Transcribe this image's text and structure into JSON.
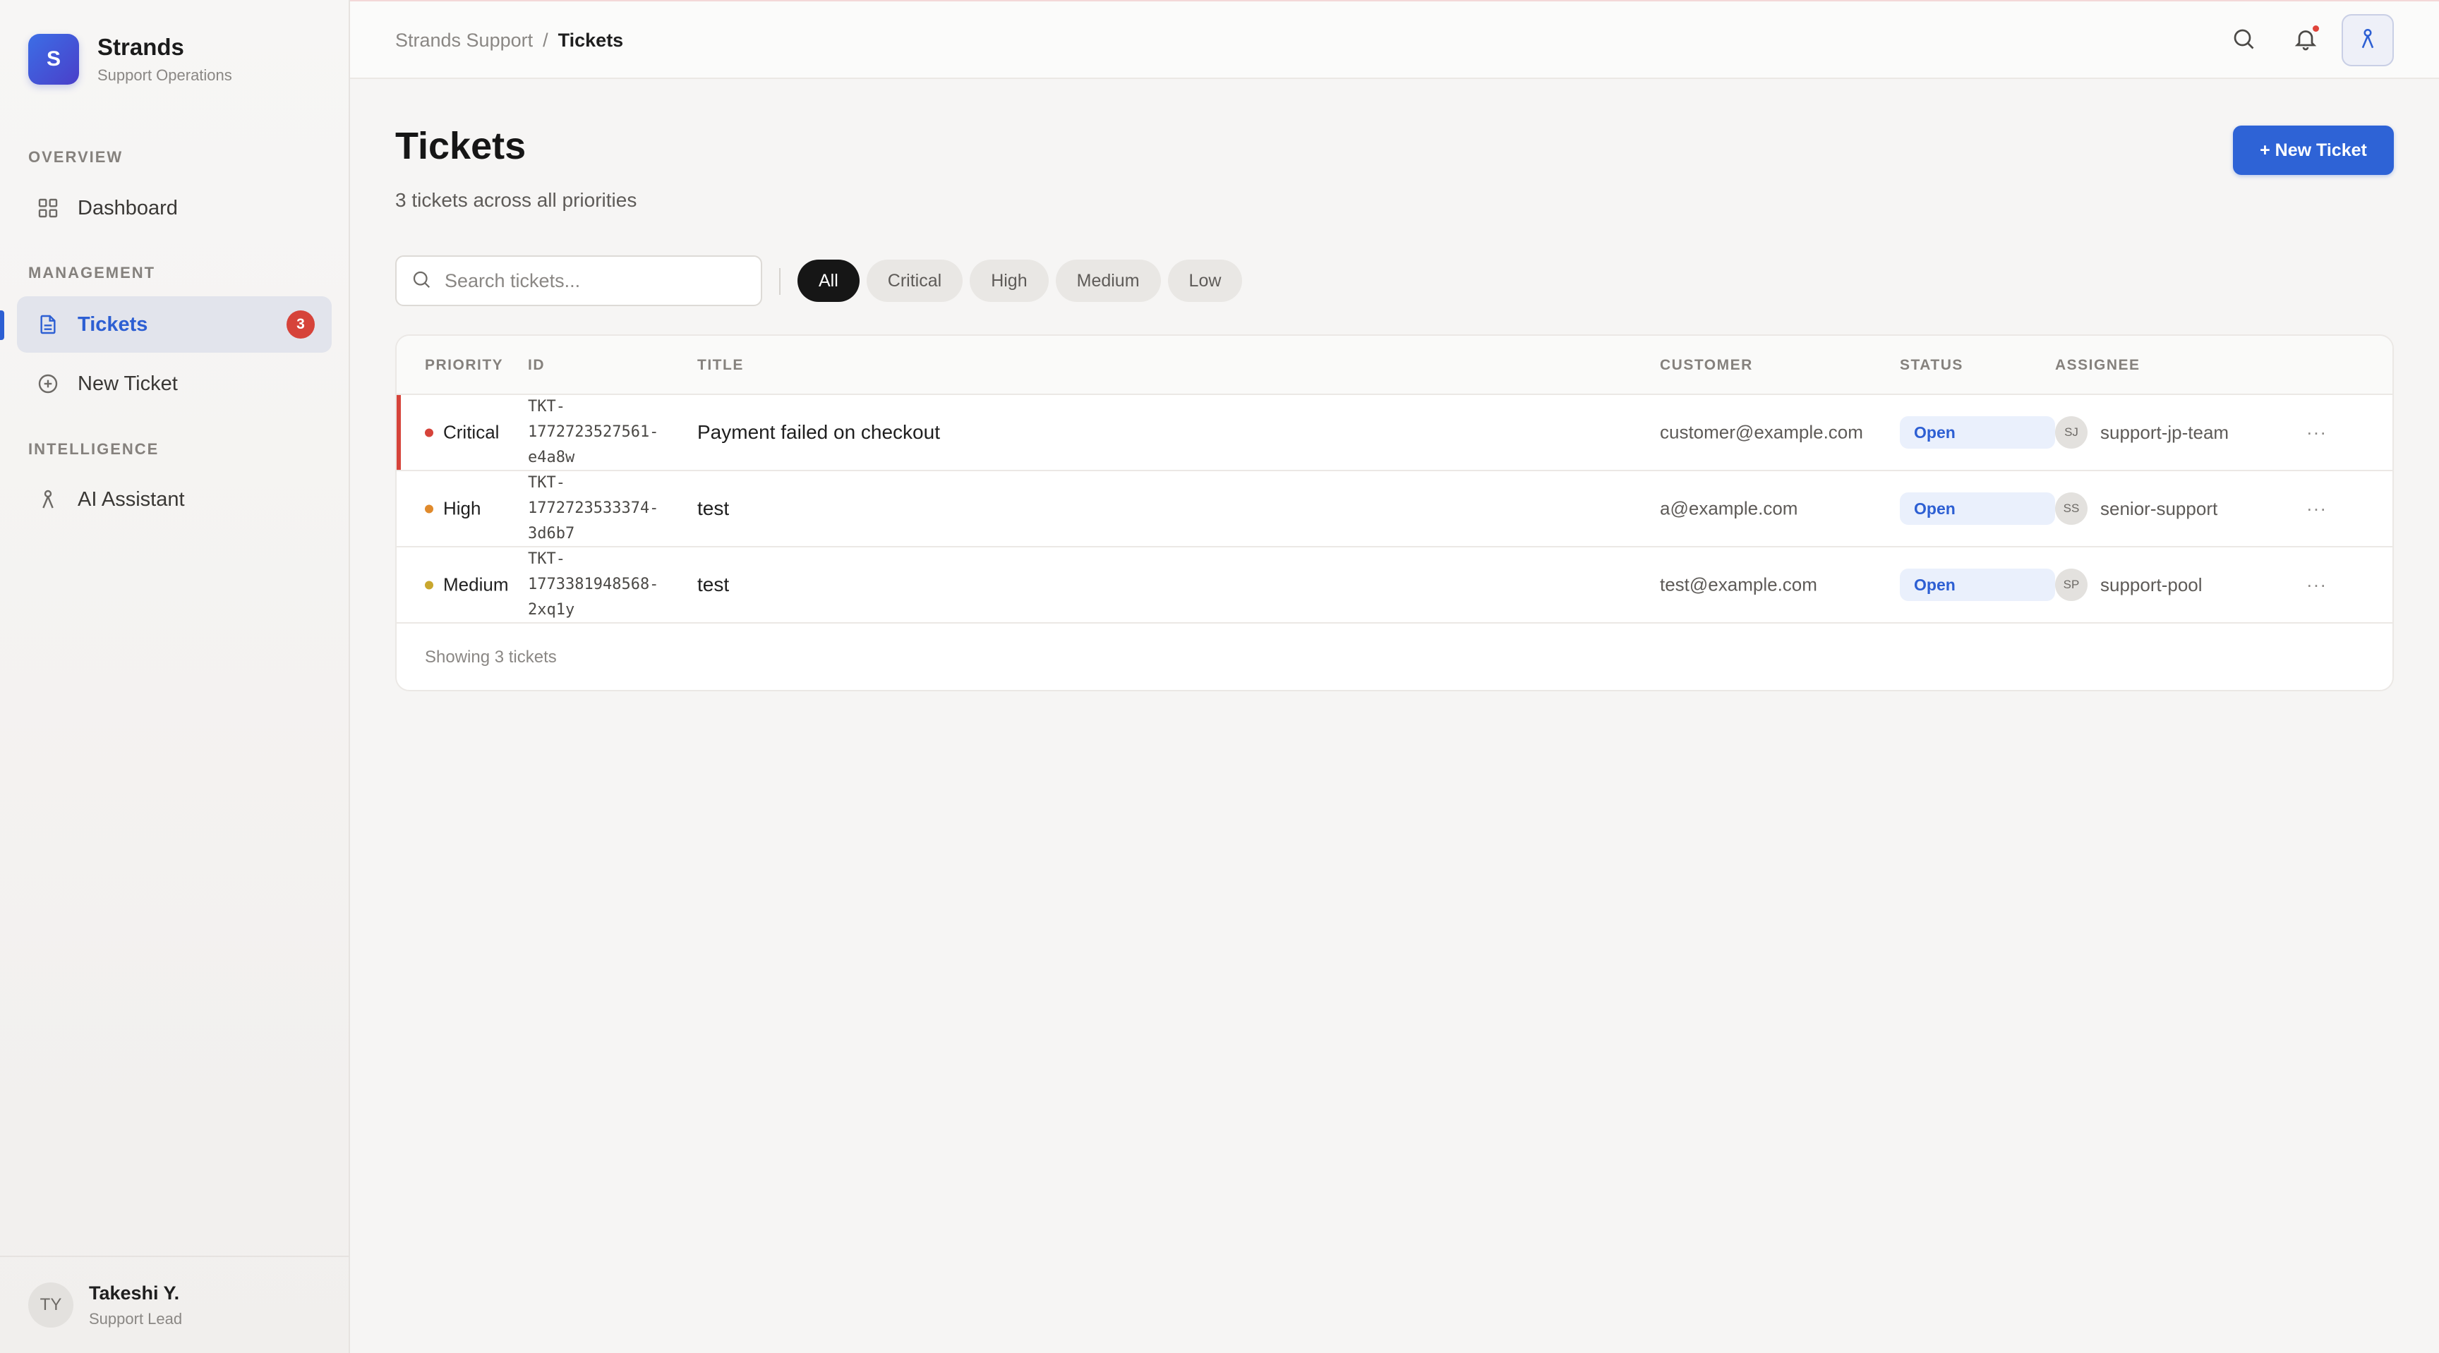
{
  "brand": {
    "logo_letter": "S",
    "name": "Strands",
    "subtitle": "Support Operations"
  },
  "nav": {
    "sections": {
      "overview": "OVERVIEW",
      "management": "MANAGEMENT",
      "intelligence": "INTELLIGENCE"
    },
    "items": [
      {
        "label": "Dashboard",
        "icon": "grid-icon"
      },
      {
        "label": "Tickets",
        "icon": "document-icon",
        "badge": "3",
        "active": true
      },
      {
        "label": "New Ticket",
        "icon": "plus-circle-icon"
      },
      {
        "label": "AI Assistant",
        "icon": "person-icon"
      }
    ]
  },
  "user": {
    "initials": "TY",
    "name": "Takeshi Y.",
    "role": "Support Lead"
  },
  "topbar": {
    "breadcrumb_root": "Strands Support",
    "breadcrumb_sep": "/",
    "breadcrumb_current": "Tickets"
  },
  "page": {
    "title": "Tickets",
    "subtitle": "3 tickets across all priorities",
    "new_ticket_label": "+ New Ticket",
    "search_placeholder": "Search tickets...",
    "filters": [
      "All",
      "Critical",
      "High",
      "Medium",
      "Low"
    ],
    "active_filter": "All"
  },
  "table": {
    "headers": {
      "priority": "PRIORITY",
      "id": "ID",
      "title": "TITLE",
      "customer": "CUSTOMER",
      "status": "STATUS",
      "assignee": "ASSIGNEE"
    },
    "rows": [
      {
        "priority": "Critical",
        "priority_color": "#d6433a",
        "id": "TKT-\n1772723527561-\ne4a8w",
        "title": "Payment failed on checkout",
        "customer": "customer@example.com",
        "status": "Open",
        "assignee_initials": "SJ",
        "assignee": "support-jp-team",
        "more": "···"
      },
      {
        "priority": "High",
        "priority_color": "#e08a2c",
        "id": "TKT-\n1772723533374-\n3d6b7",
        "title": "test",
        "customer": "a@example.com",
        "status": "Open",
        "assignee_initials": "SS",
        "assignee": "senior-support",
        "more": "···"
      },
      {
        "priority": "Medium",
        "priority_color": "#c9a72e",
        "id": "TKT-\n1773381948568-\n2xq1y",
        "title": "test",
        "customer": "test@example.com",
        "status": "Open",
        "assignee_initials": "SP",
        "assignee": "support-pool",
        "more": "···"
      }
    ],
    "footer": "Showing 3 tickets"
  },
  "colors": {
    "accent": "#2e63d6",
    "critical": "#d6433a",
    "high": "#e08a2c",
    "medium": "#c9a72e"
  }
}
